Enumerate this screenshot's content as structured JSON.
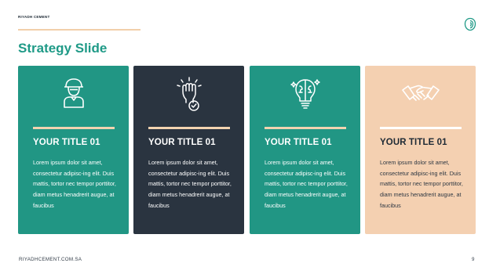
{
  "brand": "RIYADH CEMENT",
  "title": "Strategy Slide",
  "cards": [
    {
      "heading": "YOUR TITLE 01",
      "body": "Lorem ipsum dolor sit amet, consectetur adipisc-ing elit. Duis mattis, tortor nec tempor porttitor, diam metus henadrerit augue, at faucibus",
      "icon": "worker-icon",
      "bg": "#219684",
      "rule": "#f2d3b0"
    },
    {
      "heading": "YOUR TITLE 01",
      "body": "Lorem ipsum dolor sit amet, consectetur adipisc-ing elit. Duis mattis, tortor nec tempor porttitor, diam metus henadrerit augue, at faucibus",
      "icon": "raised-fist-check-icon",
      "bg": "#2a3440",
      "rule": "#f2d3b0"
    },
    {
      "heading": "YOUR TITLE 01",
      "body": "Lorem ipsum dolor sit amet, consectetur adipisc-ing elit. Duis mattis, tortor nec tempor porttitor, diam metus henadrerit augue, at faucibus",
      "icon": "brain-bulb-icon",
      "bg": "#219684",
      "rule": "#f2d3b0"
    },
    {
      "heading": "YOUR TITLE 01",
      "body": "Lorem ipsum dolor sit amet, consectetur adipisc-ing elit. Duis mattis, tortor nec tempor porttitor, diam metus henadrerit augue, at faucibus",
      "icon": "handshake-icon",
      "bg": "#f4d0b1",
      "rule": "#ffffff"
    }
  ],
  "footer": {
    "url": "RIYADHCEMENT.COM.SA",
    "page": "9"
  },
  "colors": {
    "accent": "#1f9a87",
    "dark": "#2a3440",
    "peach": "#f4d0b1"
  }
}
